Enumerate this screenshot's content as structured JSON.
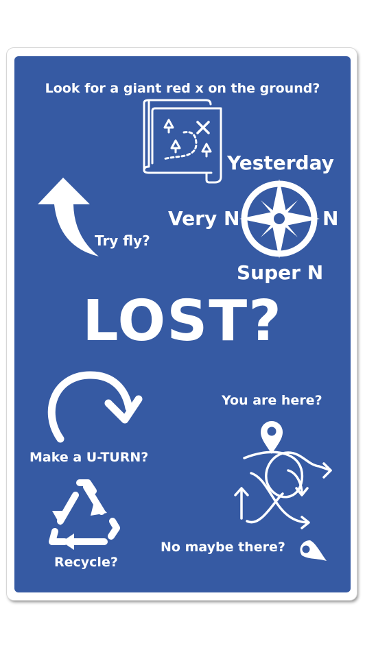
{
  "sign": {
    "background_color": "#365aa3",
    "text_color": "#ffffff",
    "headline": "LOST?",
    "treasure_map_question": "Look for a giant red x on the ground?",
    "compass": {
      "top_label": "Yesterday",
      "left_label": "Very N",
      "right_label": "N",
      "bottom_label": "Super N"
    },
    "fly_question": "Try fly?",
    "uturn_question": "Make a U-TURN?",
    "recycle_question": "Recycle?",
    "location_question": "You are here?",
    "alternate_location_question": "No maybe there?"
  },
  "icons": {
    "map": "treasure-map-icon",
    "compass": "compass-rose-icon",
    "arrow_up": "curved-arrow-up-icon",
    "uturn": "u-turn-arrow-icon",
    "recycle": "recycle-icon",
    "pin": "location-pin-icon",
    "tangled_paths": "tangled-path-arrows-icon",
    "fallen_pin": "tipped-location-pin-icon"
  }
}
